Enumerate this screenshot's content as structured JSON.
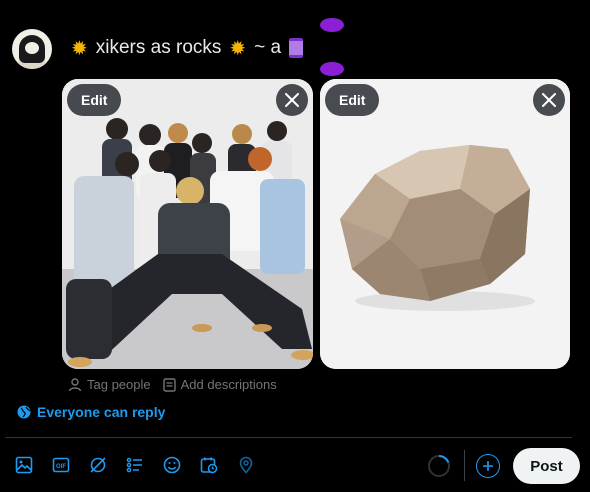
{
  "composer": {
    "text_main": "xikers as rocks",
    "text_tail": "~ a",
    "emoji_sun": "✹",
    "emoji_spool": "spool-of-thread",
    "avatar": "user-avatar"
  },
  "media": [
    {
      "edit_label": "Edit",
      "close_icon": "close-icon",
      "content": "group-photo"
    },
    {
      "edit_label": "Edit",
      "close_icon": "close-icon",
      "content": "rock-photo"
    }
  ],
  "media_actions": {
    "tag_people": "Tag people",
    "add_descriptions": "Add descriptions"
  },
  "reply_setting": {
    "label": "Everyone can reply",
    "icon": "globe-icon"
  },
  "toolbar": {
    "icons": [
      "image-icon",
      "gif-icon",
      "grok-icon",
      "poll-icon",
      "emoji-icon",
      "schedule-icon",
      "location-icon"
    ]
  },
  "post_button": {
    "label": "Post"
  },
  "colors": {
    "accent": "#1d9bf0",
    "background": "#000000",
    "text": "#e7e9ea",
    "muted": "#71767b",
    "post_bg": "#eff3f4"
  }
}
